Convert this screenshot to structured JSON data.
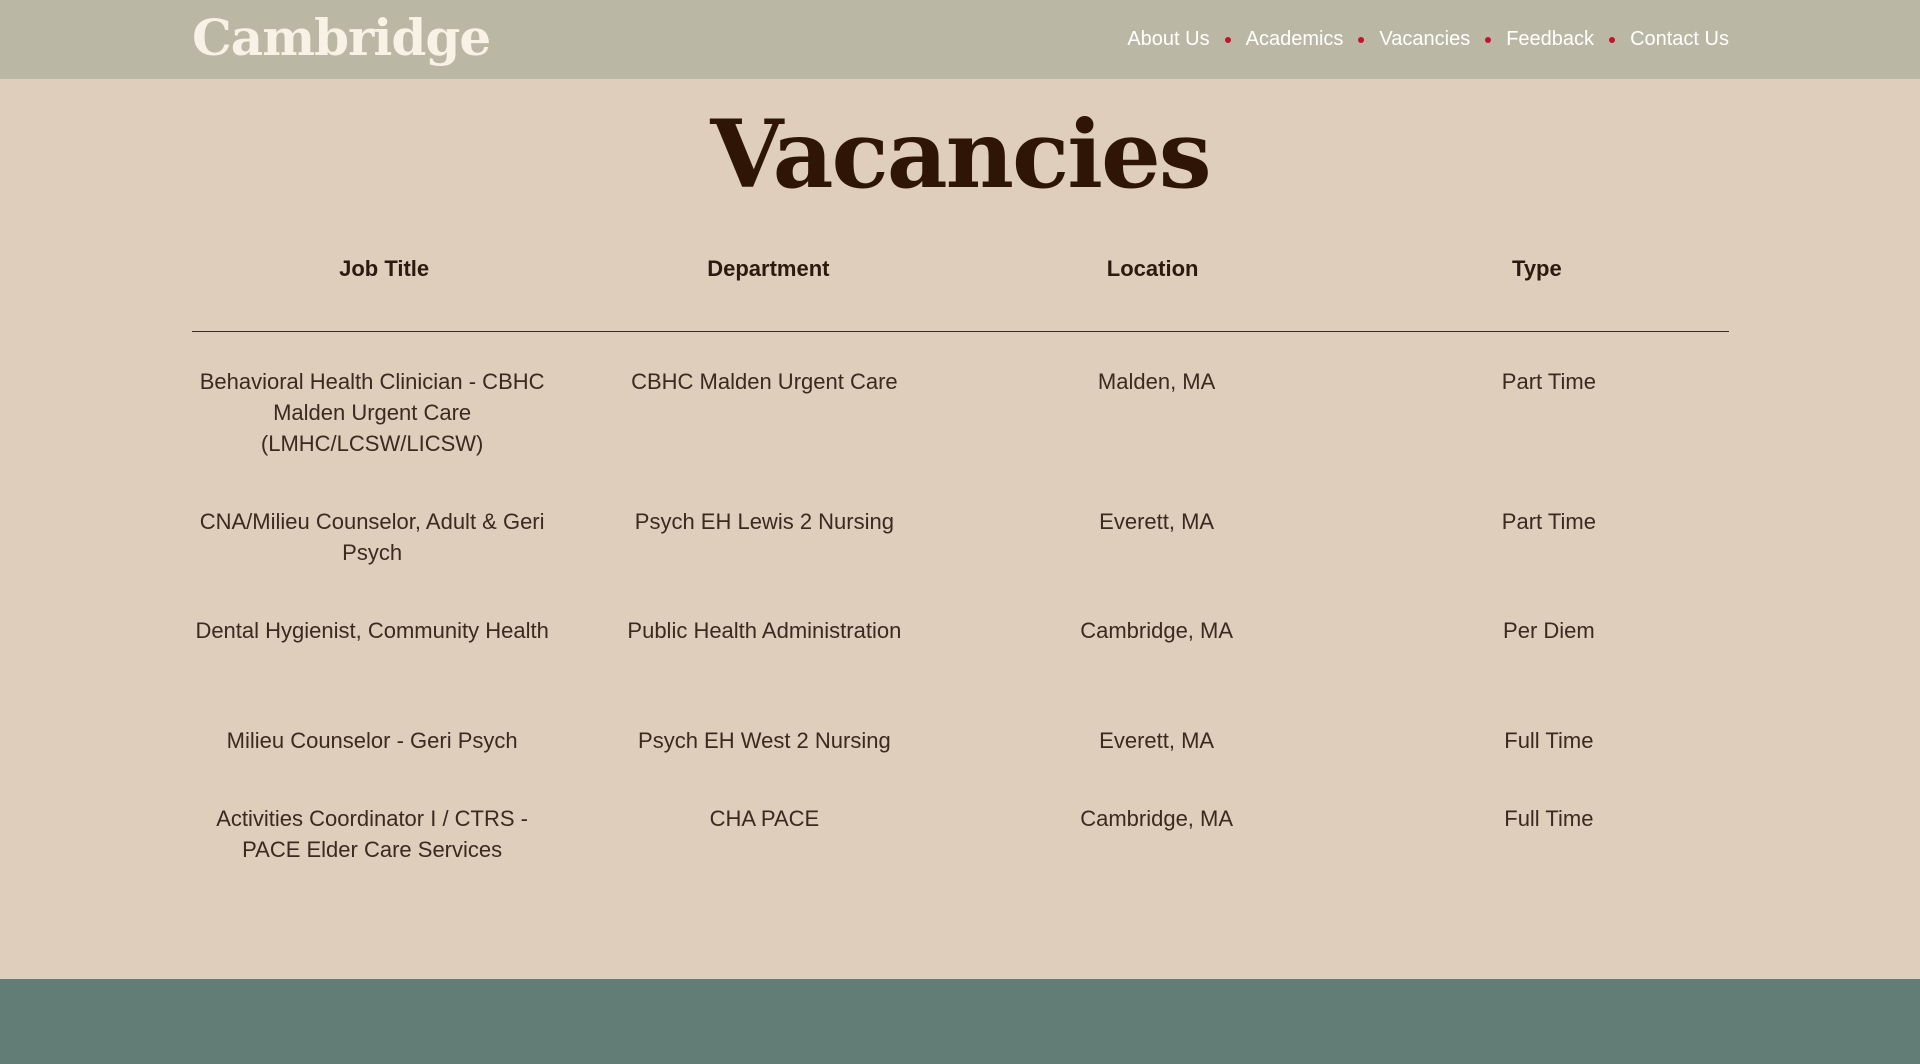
{
  "header": {
    "logo": "Cambridge",
    "nav": [
      "About Us",
      "Academics",
      "Vacancies",
      "Feedback",
      "Contact Us"
    ]
  },
  "page": {
    "title": "Vacancies"
  },
  "table": {
    "columns": [
      "Job Title",
      "Department",
      "Location",
      "Type"
    ],
    "rows": [
      [
        "Behavioral Health Clinician - CBHC Malden Urgent Care (LMHC/LCSW/LICSW)",
        "CBHC Malden Urgent Care",
        "Malden, MA",
        "Part Time"
      ],
      [
        "CNA/Milieu Counselor, Adult & Geri Psych",
        "Psych EH Lewis 2 Nursing",
        "Everett, MA",
        "Part Time"
      ],
      [
        "Dental Hygienist, Community Health",
        "Public Health Administration",
        "Cambridge, MA",
        "Per Diem"
      ],
      [
        "Milieu Counselor - Geri Psych",
        "Psych EH West 2 Nursing",
        "Everett, MA",
        "Full Time"
      ],
      [
        "Activities Coordinator I / CTRS - PACE Elder Care Services",
        "CHA PACE",
        "Cambridge, MA",
        "Full Time"
      ]
    ]
  },
  "colors": {
    "header_bg": "#bab8a5",
    "page_bg": "#decebb",
    "footer_bg": "#627d76",
    "nav_dot": "#c4122f",
    "title": "#2e1505"
  }
}
